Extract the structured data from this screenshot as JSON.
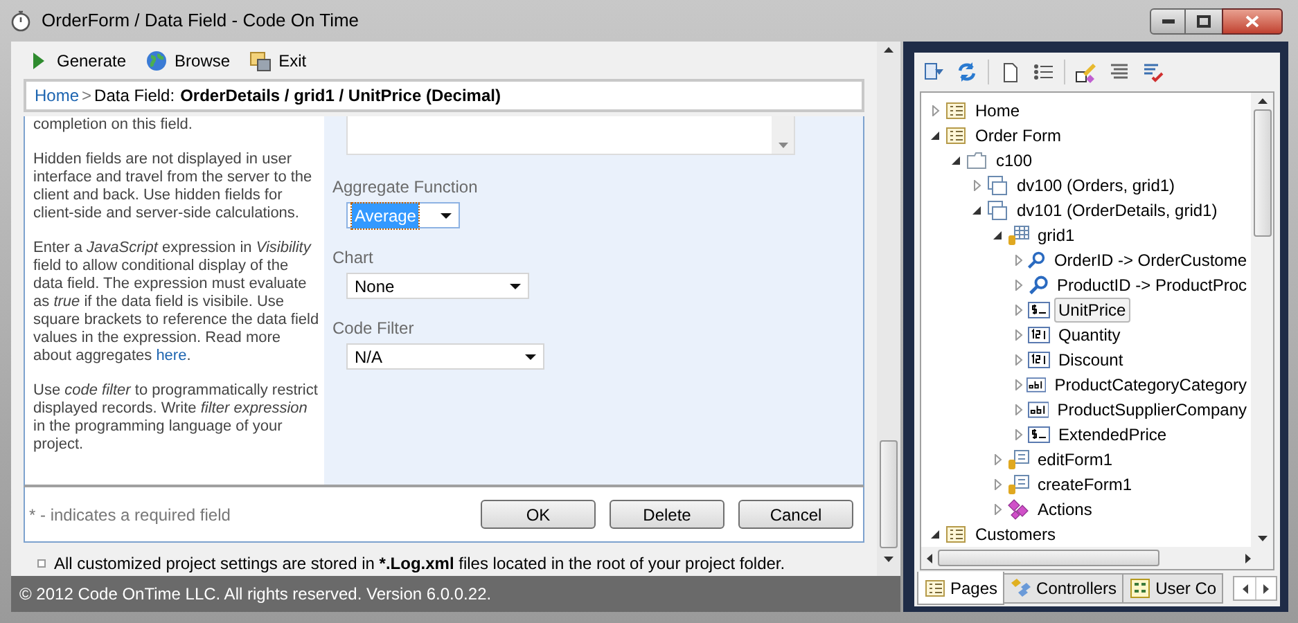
{
  "window": {
    "title": "OrderForm / Data Field - Code On Time"
  },
  "toolbar": [
    {
      "kind": "play",
      "label": "Generate"
    },
    {
      "kind": "globe",
      "label": "Browse"
    },
    {
      "kind": "exit",
      "label": "Exit"
    }
  ],
  "breadcrumb": {
    "link": "Home",
    "separator": ">",
    "label": "Data Field:",
    "value": "OrderDetails / grid1 / UnitPrice (Decimal)"
  },
  "help": [
    {
      "text": "completion on this field."
    },
    {
      "text": "Hidden fields are not displayed in user interface and travel from the server to the client and back. Use hidden fields for client-side and server-side calculations."
    },
    {
      "text": "Enter a *JavaScript* expression in *Visibility* field to allow conditional display of the data field. The expression must evaluate as *true* if the data field is visibile. Use square brackets to reference the data field values in the expression. Read more about aggregates ",
      "link": "here",
      "after": "."
    },
    {
      "text": "Use *code filter* to programmatically restrict displayed records. Write *filter expression* in the programming language of your project."
    }
  ],
  "fields": [
    {
      "label": "Aggregate Function",
      "value": "Average",
      "focused": true
    },
    {
      "label": "Chart",
      "value": "None",
      "focused": false
    },
    {
      "label": "Code Filter",
      "value": "N/A",
      "focused": false
    }
  ],
  "required_note": "* - indicates a required field",
  "buttons": [
    "OK",
    "Delete",
    "Cancel"
  ],
  "note": {
    "before": "All customized project settings are stored in ",
    "bold": "*.Log.xml",
    "after": " files located in the root of your project folder."
  },
  "status_bar": "© 2012 Code OnTime LLC. All rights reserved. Version 6.0.0.22.",
  "tree": {
    "items": [
      {
        "kind": "page",
        "label": "Home",
        "expanded": false,
        "selected": false
      },
      {
        "kind": "page",
        "label": "Order Form",
        "expanded": true,
        "selected": false,
        "children": [
          {
            "kind": "container",
            "label": "c100",
            "expanded": true,
            "selected": false,
            "children": [
              {
                "kind": "view",
                "label": "dv100 (Orders, grid1)",
                "expanded": false,
                "selected": false
              },
              {
                "kind": "view",
                "label": "dv101 (OrderDetails, grid1)",
                "expanded": true,
                "selected": false,
                "children": [
                  {
                    "kind": "grid",
                    "label": "grid1",
                    "expanded": true,
                    "selected": false,
                    "children": [
                      {
                        "kind": "lookup",
                        "label": "OrderID -> OrderCustome",
                        "expanded": false,
                        "selected": false
                      },
                      {
                        "kind": "lookup",
                        "label": "ProductID -> ProductProc",
                        "expanded": false,
                        "selected": false
                      },
                      {
                        "kind": "money",
                        "label": "UnitPrice",
                        "expanded": false,
                        "selected": true
                      },
                      {
                        "kind": "number",
                        "label": "Quantity",
                        "expanded": false,
                        "selected": false
                      },
                      {
                        "kind": "number",
                        "label": "Discount",
                        "expanded": false,
                        "selected": false
                      },
                      {
                        "kind": "text",
                        "label": "ProductCategoryCategory",
                        "expanded": false,
                        "selected": false
                      },
                      {
                        "kind": "text",
                        "label": "ProductSupplierCompany",
                        "expanded": false,
                        "selected": false
                      },
                      {
                        "kind": "money",
                        "label": "ExtendedPrice",
                        "expanded": false,
                        "selected": false
                      }
                    ]
                  },
                  {
                    "kind": "form",
                    "label": "editForm1",
                    "expanded": false,
                    "selected": false
                  },
                  {
                    "kind": "form",
                    "label": "createForm1",
                    "expanded": false,
                    "selected": false
                  },
                  {
                    "kind": "actions",
                    "label": "Actions",
                    "expanded": false,
                    "selected": false
                  }
                ]
              }
            ]
          }
        ]
      },
      {
        "kind": "page",
        "label": "Customers",
        "expanded": true,
        "selected": false
      }
    ]
  },
  "tabs": [
    {
      "kind": "pages",
      "label": "Pages",
      "selected": true
    },
    {
      "kind": "controllers",
      "label": "Controllers",
      "selected": false
    },
    {
      "kind": "controls",
      "label": "User Co",
      "selected": false
    }
  ]
}
